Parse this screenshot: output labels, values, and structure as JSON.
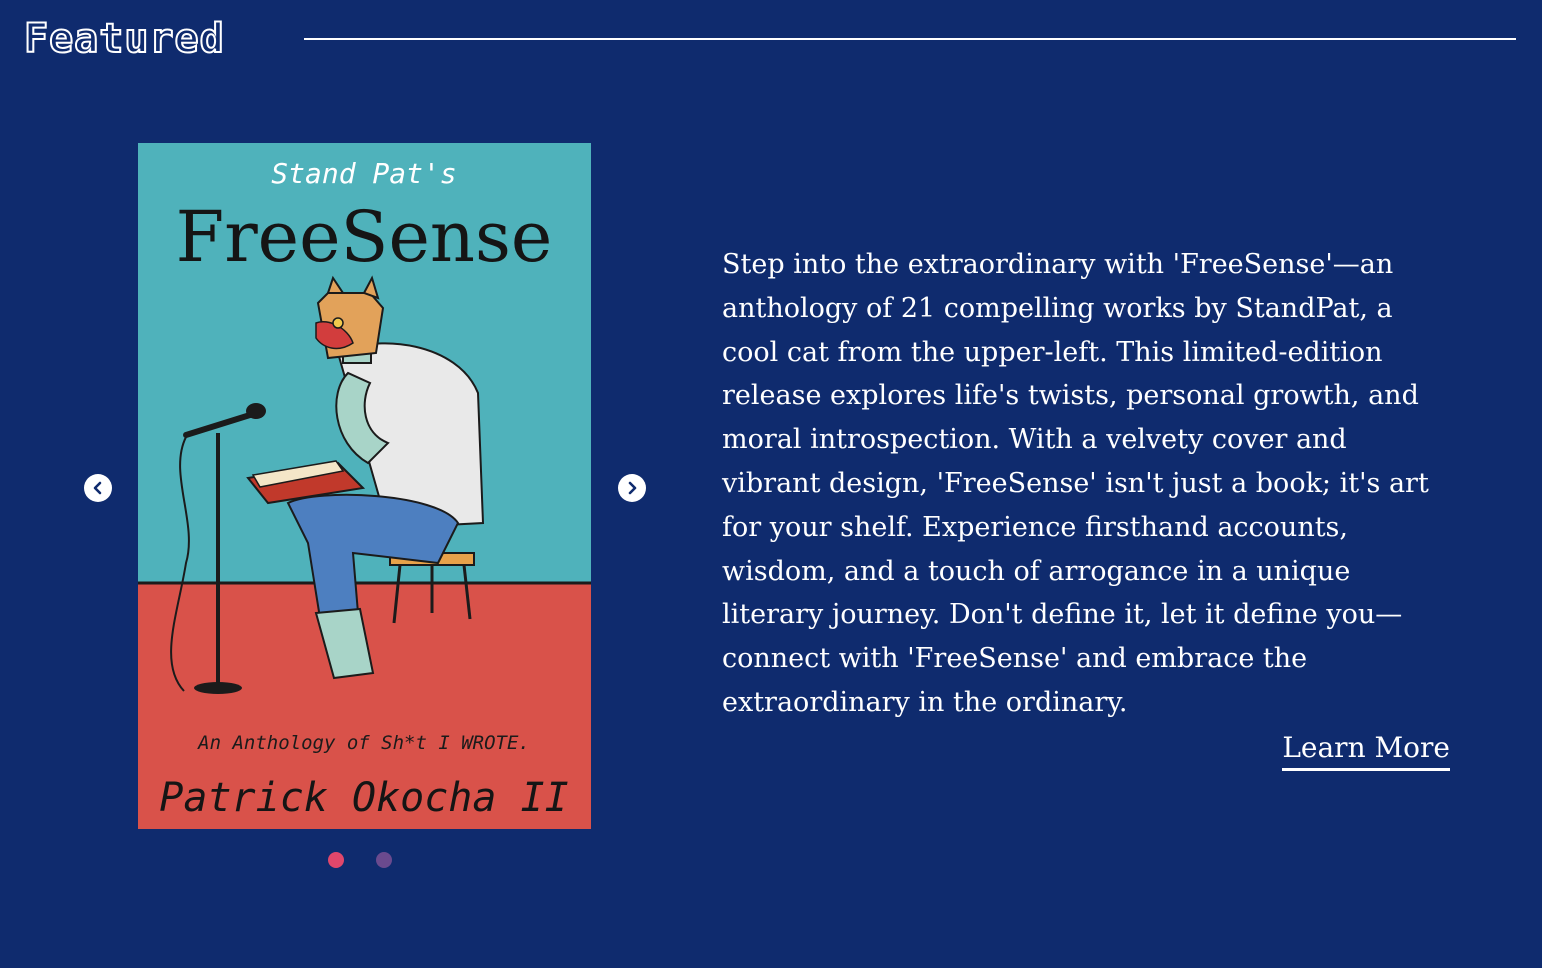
{
  "section": {
    "title": "Featured"
  },
  "carousel": {
    "prev_icon": "chevron-left-icon",
    "next_icon": "chevron-right-icon",
    "active_slide": 1,
    "slide_count": 2,
    "dot_active_color": "#e0476b",
    "dot_inactive_color": "#6a4a8e",
    "book": {
      "series_label": "Stand Pat's",
      "title": "FreeSense",
      "subtitle": "An Anthology of Sh*t I WROTE.",
      "author": "Patrick Okocha II",
      "cover_top_color": "#4fb2bb",
      "cover_bottom_color": "#d9524a"
    }
  },
  "featured": {
    "description": "Step into the extraordinary with 'FreeSense'—an anthology of 21 compelling works by StandPat, a cool cat from the upper-left. This limited-edition release explores life's twists, personal growth, and moral introspection. With a velvety cover and vibrant design, 'FreeSense' isn't just a book; it's art for your shelf. Experience firsthand accounts, wisdom, and a touch of arrogance in a unique literary journey. Don't define it, let it define you—connect with 'FreeSense' and embrace the extraordinary in the ordinary.",
    "learn_more_label": "Learn More"
  },
  "colors": {
    "background": "#0f2b6e",
    "text": "#ffffff"
  }
}
